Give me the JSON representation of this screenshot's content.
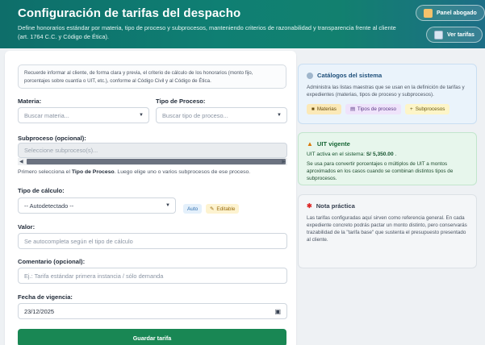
{
  "header": {
    "title": "Configuración de tarifas del despacho",
    "subtitle": "Define honorarios estándar por materia, tipo de proceso y subprocesos, manteniendo criterios de razonabilidad y transparencia frente al cliente (art. 1764 C.C. y Código de Ética).",
    "panel_button": "Panel abogado",
    "tarifas_button": "Ver tarifas"
  },
  "form": {
    "note": "Recuerde informar al cliente, de forma clara y previa, el criterio de cálculo de los honorarios (monto fijo, porcentajes sobre cuantía o UIT, etc.), conforme al Código Civil y al Código de Ética.",
    "materia_label": "Materia:",
    "materia_placeholder": "Buscar materia...",
    "tipo_label": "Tipo de Proceso:",
    "tipo_placeholder": "Buscar tipo de proceso...",
    "subproceso_label": "Subproceso (opcional):",
    "subproceso_placeholder": "Seleccione subproceso(s)...",
    "subproceso_hint_pre": "Primero selecciona el ",
    "subproceso_hint_bold": "Tipo de Proceso",
    "subproceso_hint_post": ". Luego elige uno o varios subprocesos de ese proceso.",
    "calculo_label": "Tipo de cálculo:",
    "calculo_value": "-- Autodetectado --",
    "badge_auto": "Auto",
    "badge_editable": "Editable",
    "valor_label": "Valor:",
    "valor_placeholder": "Se autocompleta según el tipo de cálculo",
    "comentario_label": "Comentario (opcional):",
    "comentario_placeholder": "Ej.: Tarifa estándar primera instancia / sólo demanda",
    "fecha_label": "Fecha de vigencia:",
    "fecha_value": "23/12/2025",
    "save_button": "Guardar tarifa"
  },
  "sidebar": {
    "catalogos_title": "Catálogos del sistema",
    "catalogos_text": "Administra las listas maestras que se usan en la definición de tarifas y expedientes (materias, tipos de proceso y subprocesos).",
    "chips": [
      "Materias",
      "Tipos de proceso",
      "Subprocesos"
    ],
    "uit_title": "UIT vigente",
    "uit_line_pre": "UIT activa en el sistema: ",
    "uit_value": "S/ 5,350.00",
    "uit_line_post": " .",
    "uit_text": "Se usa para convertir porcentajes o múltiplos de UIT a montos aproximados en los casos cuando se combinan distintos tipos de subprocesos.",
    "practica_title": "Nota práctica",
    "practica_text": "Las tarifas configuradas aquí sirven como referencia general. En cada expediente concreto podrás pactar un monto distinto, pero conservarás trazabilidad de la \"tarifa base\" que sustenta el presupuesto presentado al cliente."
  },
  "colors": {
    "primary": "#198754",
    "header_start": "#0e6e6a",
    "header_end": "#1d6e86"
  }
}
